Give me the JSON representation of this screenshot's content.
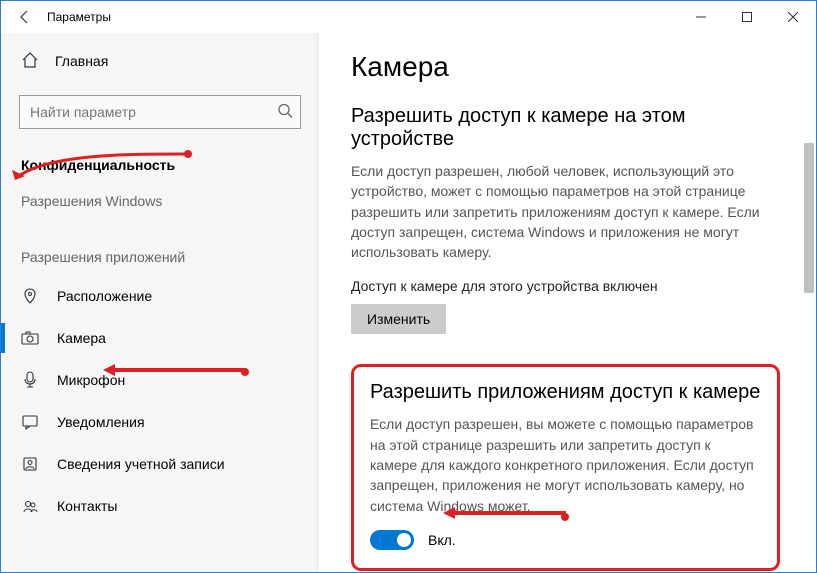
{
  "window": {
    "title": "Параметры"
  },
  "sidebar": {
    "home": "Главная",
    "search_placeholder": "Найти параметр",
    "section1": "Конфиденциальность",
    "sub1": "Разрешения Windows",
    "section2": "Разрешения приложений",
    "items": [
      {
        "label": "Расположение"
      },
      {
        "label": "Камера"
      },
      {
        "label": "Микрофон"
      },
      {
        "label": "Уведомления"
      },
      {
        "label": "Сведения учетной записи"
      },
      {
        "label": "Контакты"
      }
    ]
  },
  "main": {
    "title": "Камера",
    "sect1_title": "Разрешить доступ к камере на этом устройстве",
    "sect1_body": "Если доступ разрешен, любой человек, использующий это устройство, может с помощью параметров на этой странице разрешить или запретить приложениям доступ к камере. Если доступ запрещен, система Windows и приложения не могут использовать камеру.",
    "status": "Доступ к камере для этого устройства включен",
    "change_btn": "Изменить",
    "sect2_title": "Разрешить приложениям доступ к камере",
    "sect2_body": "Если доступ разрешен, вы можете с помощью параметров на этой странице разрешить или запретить доступ к камере для каждого конкретного приложения. Если доступ запрещен, приложения не могут использовать камеру, но система Windows может.",
    "toggle_label": "Вкл."
  }
}
